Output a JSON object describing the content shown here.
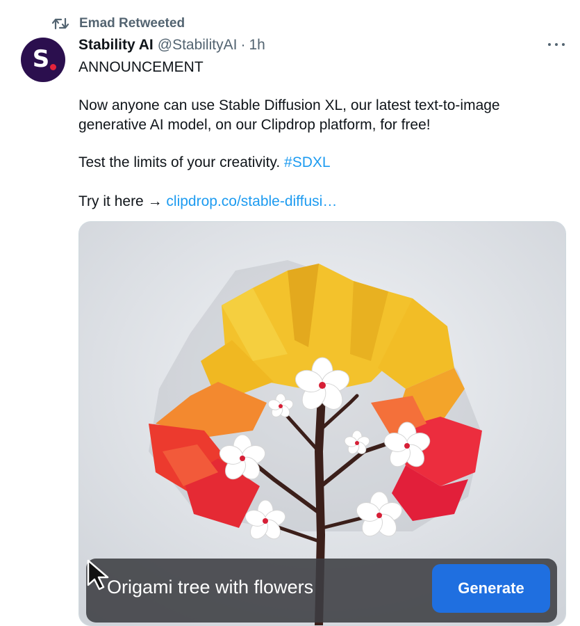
{
  "retweet": {
    "label": "Emad Retweeted"
  },
  "author": {
    "avatar_letter": "S",
    "name": "Stability AI",
    "handle": "@StabilityAI",
    "separator": "·",
    "time": "1h"
  },
  "tweet": {
    "line1": "ANNOUNCEMENT",
    "line2a": "Now anyone can use Stable Diffusion XL, our latest text-to-image",
    "line2b": "generative AI model, on our Clipdrop platform, for free!",
    "line3": "Test the limits of your creativity.",
    "hashtag": "#SDXL",
    "line4": "Try it here →",
    "link": "clipdrop.co/stable-diffusi…"
  },
  "media": {
    "prompt": "Origami tree with flowers",
    "button_label": "Generate"
  },
  "colors": {
    "link": "#1d9bf0",
    "avatar_bg": "#2b0f4e",
    "button": "#1f6fe0",
    "muted": "#536471"
  },
  "icons": {
    "retweet": "retweet-icon",
    "more": "more-icon",
    "cursor": "cursor-icon"
  }
}
